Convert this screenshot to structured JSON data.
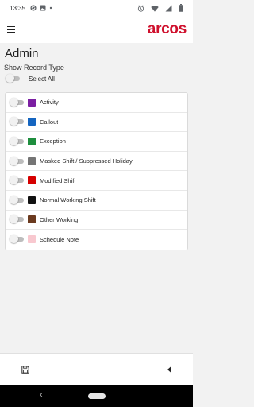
{
  "status_bar": {
    "time": "13:35",
    "icons": [
      "sync-icon",
      "photo-icon",
      "dot-icon",
      "alarm-icon",
      "wifi-icon",
      "signal-icon",
      "battery-icon"
    ]
  },
  "app_bar": {
    "menu_icon": "hamburger-menu-icon",
    "logo_text": "arcos",
    "logo_color": "#cf102d"
  },
  "page": {
    "title": "Admin",
    "subtitle": "Show Record Type",
    "select_all_label": "Select All",
    "select_all_checked": false
  },
  "record_types": [
    {
      "label": "Activity",
      "color": "#7b1fa2",
      "enabled": false
    },
    {
      "label": "Callout",
      "color": "#1565c0",
      "enabled": false
    },
    {
      "label": "Exception",
      "color": "#1e8e3e",
      "enabled": false
    },
    {
      "label": "Masked Shift / Suppressed Holiday",
      "color": "#757575",
      "enabled": false
    },
    {
      "label": "Modified Shift",
      "color": "#d50000",
      "enabled": false
    },
    {
      "label": "Normal Working Shift",
      "color": "#111111",
      "enabled": false
    },
    {
      "label": "Other Working",
      "color": "#6b3a1f",
      "enabled": false
    },
    {
      "label": "Schedule Note",
      "color": "#f8c8cf",
      "enabled": false
    }
  ],
  "bottom_bar": {
    "save_icon": "save-icon",
    "back_icon": "caret-left-icon"
  },
  "nav_bar": {
    "back_glyph": "‹"
  }
}
